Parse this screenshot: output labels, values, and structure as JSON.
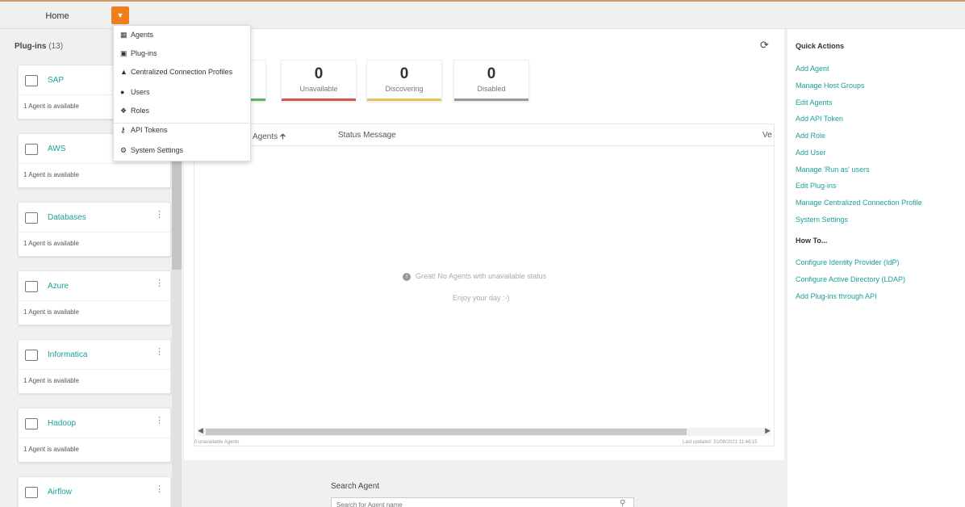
{
  "topbar": {
    "home_label": "Home",
    "menu_icon": "chevron-down-icon"
  },
  "menu": {
    "items": [
      {
        "label": "Agents",
        "icon": "agents-icon"
      },
      {
        "label": "Plug-ins",
        "icon": "plugins-icon"
      },
      {
        "label": "Centralized Connection Profiles",
        "icon": "connection-profile-icon"
      },
      {
        "label": "Users",
        "icon": "users-icon"
      },
      {
        "label": "Roles",
        "icon": "roles-icon"
      },
      {
        "label": "API Tokens",
        "icon": "key-icon"
      },
      {
        "label": "System Settings",
        "icon": "gear-icon"
      }
    ]
  },
  "plugins": {
    "title": "Plug-ins",
    "count": "(13)",
    "items": [
      {
        "name": "SAP",
        "availability": "1 Agent is available"
      },
      {
        "name": "AWS",
        "availability": "1 Agent is available"
      },
      {
        "name": "Databases",
        "availability": "1 Agent is available"
      },
      {
        "name": "Azure",
        "availability": "1 Agent is available"
      },
      {
        "name": "Informatica",
        "availability": "1 Agent is available"
      },
      {
        "name": "Hadoop",
        "availability": "1 Agent is available"
      },
      {
        "name": "Airflow",
        "availability": ""
      }
    ]
  },
  "stats": [
    {
      "value": "0",
      "label": "Unavailable",
      "color": "#d9534f"
    },
    {
      "value": "0",
      "label": "Discovering",
      "color": "#e6c25a"
    },
    {
      "value": "0",
      "label": "Disabled",
      "color": "#999999"
    }
  ],
  "first_stat_color": "#5cb85c",
  "table": {
    "columns": [
      "Agents",
      "Status Message",
      "Ve"
    ],
    "sort_icon": "sort-up-icon",
    "empty_message": "Great! No Agents with unavailable status",
    "empty_sub": "Enjoy your day :-)",
    "footer_left": "0 unavailable Agents",
    "footer_right": "Last updated: 31/08/2021 11:46:15"
  },
  "search": {
    "label": "Search Agent",
    "placeholder": "Search for Agent name"
  },
  "quick_actions": {
    "title": "Quick Actions",
    "links": [
      "Add Agent",
      "Manage Host Groups",
      "Edit Agents",
      "Add API Token",
      "Add Role",
      "Add User",
      "Manage 'Run as' users",
      "Edit Plug-ins",
      "Manage Centralized Connection Profile",
      "System Settings"
    ]
  },
  "how_to": {
    "title": "How To...",
    "links": [
      "Configure Identity Provider (IdP)",
      "Configure Active Directory (LDAP)",
      "Add Plug-ins through API"
    ]
  }
}
